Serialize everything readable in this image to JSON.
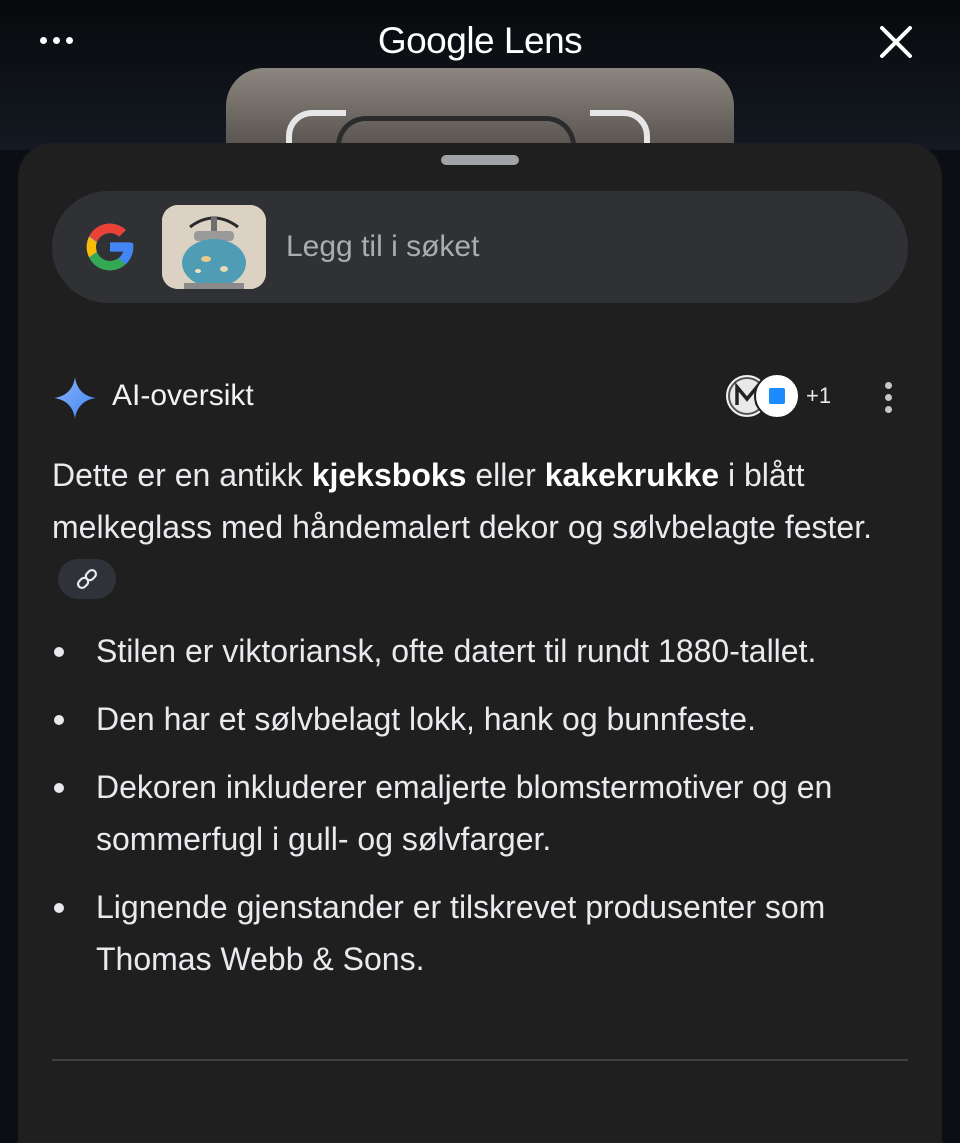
{
  "header": {
    "title": "Google Lens",
    "menu_icon": "more-horizontal-icon",
    "close_icon": "close-icon"
  },
  "search": {
    "placeholder": "Legg til i søket",
    "logo": "google-g-icon"
  },
  "ai_overview": {
    "title": "AI-oversikt",
    "source_count": "+1",
    "summary_parts": [
      "Dette er en antikk ",
      "kjeksboks",
      " eller ",
      "kakekrukke",
      " i blått melkeglass med håndemalert dekor og sølvbelagte fester."
    ],
    "bullets": [
      "Stilen er viktoriansk, ofte datert til rundt 1880-tallet.",
      "Den har et sølvbelagt lokk, hank og bunnfeste.",
      "Dekoren inkluderer emaljerte blomstermotiver og en sommerfugl i gull- og sølvfarger.",
      "Lignende gjenstander er tilskrevet produsenter som Thomas Webb & Sons."
    ]
  },
  "colors": {
    "background": "#0b0e13",
    "sheet": "#1f1f20",
    "search_bar": "#303134",
    "accent_blue": "#4285f4"
  }
}
